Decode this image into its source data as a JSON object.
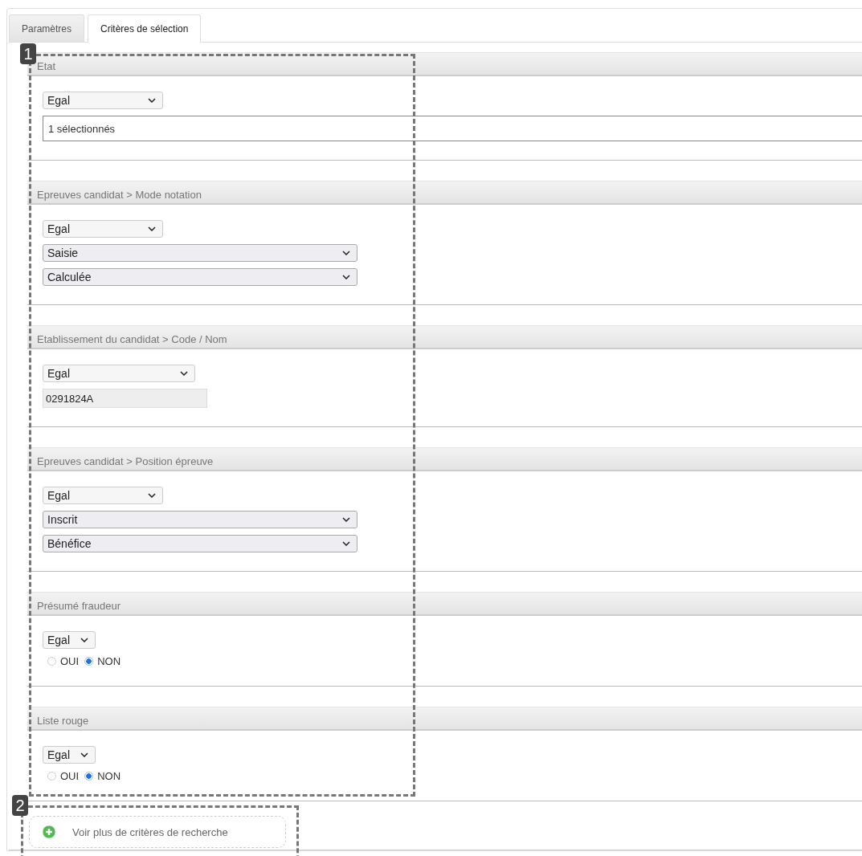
{
  "tabs": [
    {
      "label": "Paramètres",
      "selected": false
    },
    {
      "label": "Critères de sélection",
      "selected": true
    }
  ],
  "sections": [
    {
      "title": "Etat",
      "kind": "summary",
      "operator": "Egal",
      "value": "1 sélectionnés"
    },
    {
      "title": "Epreuves candidat > Mode notation",
      "kind": "selects",
      "operator": "Egal",
      "values": [
        "Saisie",
        "Calculée"
      ]
    },
    {
      "title": "Etablissement du candidat > Code / Nom",
      "kind": "text",
      "operator": "Egal",
      "value": "0291824A"
    },
    {
      "title": "Epreuves candidat > Position épreuve",
      "kind": "selects",
      "operator": "Egal",
      "values": [
        "Inscrit",
        "Bénéfice"
      ]
    },
    {
      "title": "Présumé fraudeur",
      "kind": "radio",
      "operator": "Egal",
      "options": [
        {
          "label": "OUI",
          "selected": false
        },
        {
          "label": "NON",
          "selected": true
        }
      ]
    },
    {
      "title": "Liste rouge",
      "kind": "radio",
      "operator": "Egal",
      "options": [
        {
          "label": "OUI",
          "selected": false
        },
        {
          "label": "NON",
          "selected": true
        }
      ]
    }
  ],
  "more_button": {
    "label": "Voir plus de critères de recherche"
  },
  "callouts": [
    {
      "label": "1"
    },
    {
      "label": "2"
    }
  ]
}
